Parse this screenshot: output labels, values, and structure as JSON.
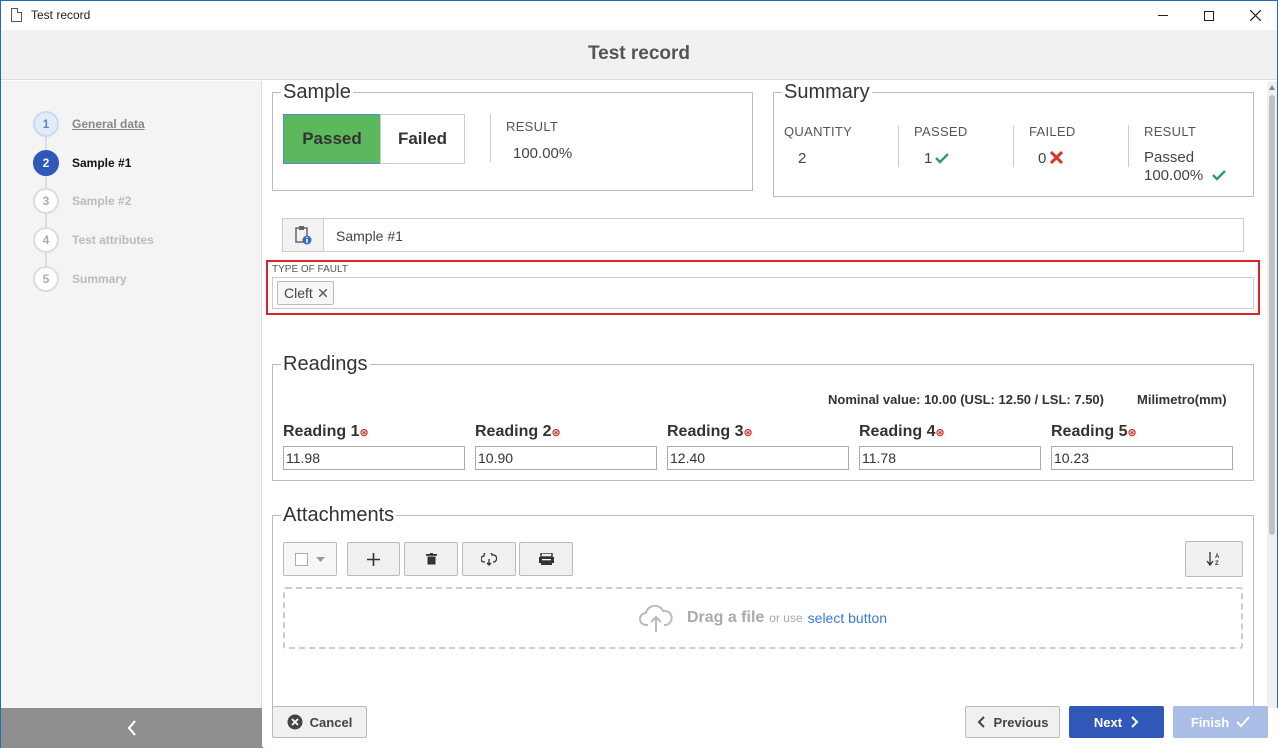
{
  "window": {
    "title": "Test record"
  },
  "header": {
    "title": "Test record"
  },
  "steps": [
    {
      "num": "1",
      "label": "General data"
    },
    {
      "num": "2",
      "label": "Sample #1"
    },
    {
      "num": "3",
      "label": "Sample #2"
    },
    {
      "num": "4",
      "label": "Test attributes"
    },
    {
      "num": "5",
      "label": "Summary"
    }
  ],
  "sample": {
    "legend": "Sample",
    "passed_label": "Passed",
    "failed_label": "Failed",
    "result_caption": "RESULT",
    "result_value": "100.00%"
  },
  "summary": {
    "legend": "Summary",
    "quantity_caption": "QUANTITY",
    "quantity_value": "2",
    "passed_caption": "PASSED",
    "passed_value": "1",
    "failed_caption": "FAILED",
    "failed_value": "0",
    "result_caption": "RESULT",
    "result_status": "Passed",
    "result_percent": "100.00%"
  },
  "sample_name": {
    "value": "Sample #1"
  },
  "fault": {
    "caption": "TYPE OF FAULT",
    "tag": "Cleft"
  },
  "readings": {
    "legend": "Readings",
    "nominal": "Nominal value: 10.00 (USL: 12.50 / LSL: 7.50)",
    "unit": "Milimetro(mm)",
    "items": [
      {
        "label": "Reading 1",
        "value": "11.98"
      },
      {
        "label": "Reading 2",
        "value": "10.90"
      },
      {
        "label": "Reading 3",
        "value": "12.40"
      },
      {
        "label": "Reading 4",
        "value": "11.78"
      },
      {
        "label": "Reading 5",
        "value": "10.23"
      }
    ]
  },
  "attachments": {
    "legend": "Attachments",
    "drop_strong": "Drag a file",
    "drop_or": "or use",
    "drop_link": "select button"
  },
  "footer": {
    "cancel": "Cancel",
    "previous": "Previous",
    "next": "Next",
    "finish": "Finish"
  },
  "colors": {
    "accent": "#2f58b8",
    "passed_green": "#5cb85c",
    "fault_border": "#d9262b",
    "link": "#3a7bd5"
  }
}
